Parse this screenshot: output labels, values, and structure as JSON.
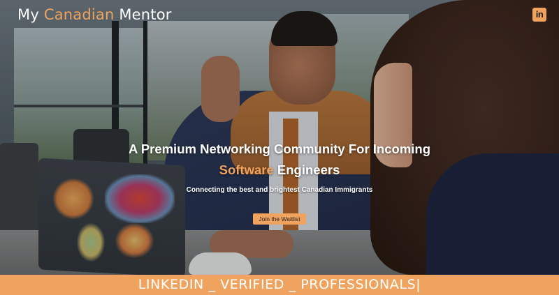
{
  "header": {
    "brand_prefix": "My ",
    "brand_accent": "Canadian",
    "brand_suffix": " Mentor",
    "social_icon": "linkedin-icon",
    "social_icon_glyph": "in"
  },
  "hero": {
    "headline_line1": "A Premium Networking Community For Incoming",
    "headline_line2_accent": "Software",
    "headline_line2_rest": " Engineers",
    "subheadline": "Connecting the best and brightest Canadian Immigrants",
    "cta_label": "Join the Waitlist"
  },
  "ticker": {
    "text": "LINKEDIN _ VERIFIED _ PROFESSIONALS|"
  },
  "colors": {
    "accent": "#f0a35e",
    "text": "#ffffff"
  }
}
